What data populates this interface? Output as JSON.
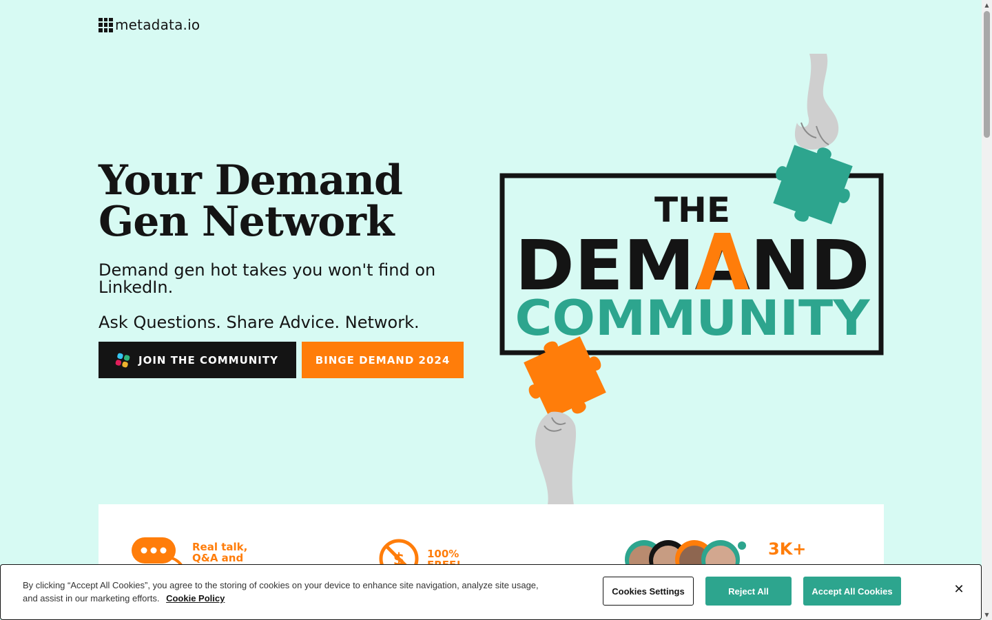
{
  "header": {
    "logo_text": "metadata.io",
    "logo_icon": "grid-logo-icon"
  },
  "hero": {
    "title": "Your Demand Gen Network",
    "subtitle": "Demand gen hot takes you won't find on LinkedIn.",
    "tagline": "Ask Questions. Share Advice. Network.",
    "join_button": "JOIN THE COMMUNITY",
    "join_icon": "slack-icon",
    "binge_button": "BINGE DEMAND 2024"
  },
  "graphic": {
    "line1": "THE",
    "line2": "DEMAND",
    "line3": "COMMUNITY",
    "accent_orange": "#ff7d0a",
    "accent_teal": "#2da58e"
  },
  "features": [
    {
      "icon": "chat-bubble-icon",
      "text": "Real talk, Q&A and"
    },
    {
      "icon": "no-money-icon",
      "text": "100% FREE!"
    },
    {
      "icon": "member-avatars-icon",
      "text": "3K+"
    }
  ],
  "cookie_banner": {
    "text": "By clicking “Accept All Cookies”, you agree to the storing of cookies on your device to enhance site navigation, analyze site usage, and assist in our marketing efforts.",
    "policy_link": "Cookie Policy",
    "settings_button": "Cookies Settings",
    "reject_button": "Reject All",
    "accept_button": "Accept All Cookies",
    "close_icon": "close-icon"
  },
  "colors": {
    "background": "#d7faf3",
    "dark": "#141414",
    "orange": "#ff7d0a",
    "teal": "#2da58e"
  }
}
